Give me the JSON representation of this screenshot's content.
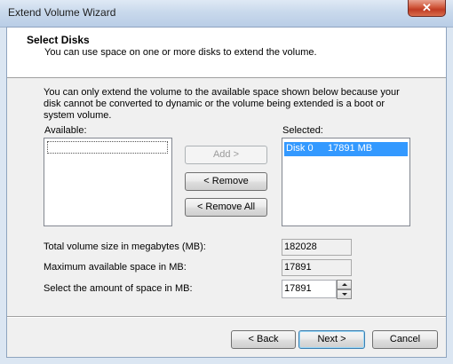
{
  "window": {
    "title": "Extend Volume Wizard"
  },
  "header": {
    "title": "Select Disks",
    "subtitle": "You can use space on one or more disks to extend the volume."
  },
  "description": "You can only extend the volume to the available space shown below because your disk cannot be converted to dynamic or the volume being extended is a boot or system volume.",
  "available": {
    "label": "Available:",
    "items": []
  },
  "selected": {
    "label": "Selected:",
    "items": [
      {
        "disk": "Disk 0",
        "size": "17891 MB"
      }
    ]
  },
  "buttons": {
    "add": "Add >",
    "remove": "< Remove",
    "remove_all": "< Remove All",
    "back": "< Back",
    "next": "Next >",
    "cancel": "Cancel"
  },
  "fields": {
    "total_label": "Total volume size in megabytes (MB):",
    "total_value": "182028",
    "max_label": "Maximum available space in MB:",
    "max_value": "17891",
    "amount_label": "Select the amount of space in MB:",
    "amount_value": "17891"
  },
  "colors": {
    "selection": "#3399ff",
    "close_button": "#c03c24"
  }
}
